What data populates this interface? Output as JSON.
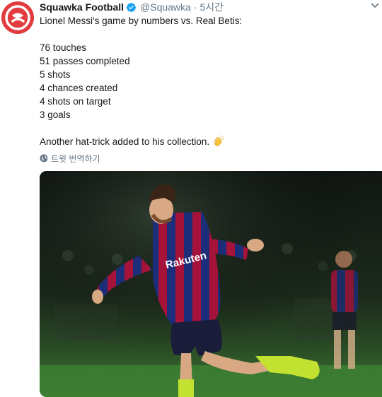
{
  "tweet": {
    "author_name": "Squawka Football",
    "handle": "@Squawka",
    "separator": "·",
    "time": "5시간",
    "lines": [
      "Lionel Messi's game by numbers vs. Real Betis:",
      "",
      "76 touches",
      "51 passes completed",
      "5 shots",
      "4 chances created",
      "4 shots on target",
      "3 goals",
      "",
      "Another hat-trick added to his collection."
    ],
    "closing_emoji": "clapping-hands",
    "translate_label": "트윗 번역하기"
  },
  "photo": {
    "shirt_sponsor": "Rakuten",
    "description_icon": "player-celebration-photo"
  },
  "colors": {
    "brand_red": "#e23c3f",
    "verified_blue": "#1da1f2",
    "muted_text": "#657786",
    "pitch_green": "#2f6a2a"
  }
}
